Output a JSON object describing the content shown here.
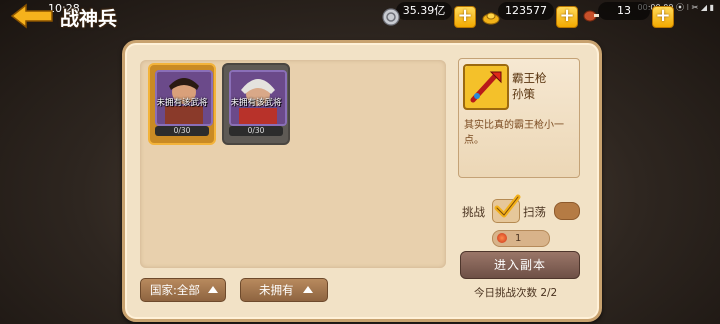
{
  "status": {
    "time": "10:28",
    "right": "00:00:00 ⦿ ⁝ ✂ ◢ ▮"
  },
  "header": {
    "title": "战神兵"
  },
  "resources": {
    "silver": "35.39亿",
    "gold": "123577",
    "stamina": "13"
  },
  "cards": [
    {
      "label": "未拥有该武将",
      "count": "0/30",
      "selected": true
    },
    {
      "label": "未拥有该武将",
      "count": "0/30",
      "selected": false
    }
  ],
  "info": {
    "weapon_name": "霸王枪",
    "owner": "孙策",
    "description": "其实比真的霸王枪小一点。"
  },
  "controls": {
    "challenge_label": "挑战",
    "sweep_label": "扫荡",
    "count_value": "1",
    "enter_label": "进入副本",
    "daily_label": "今日挑战次数",
    "daily_value": "2/2"
  },
  "filters": {
    "country_label": "国家:全部",
    "own_label": "未拥有"
  },
  "colors": {
    "accent": "#f2a900",
    "panel": "#f2e2c6",
    "button": "#8e6440"
  }
}
